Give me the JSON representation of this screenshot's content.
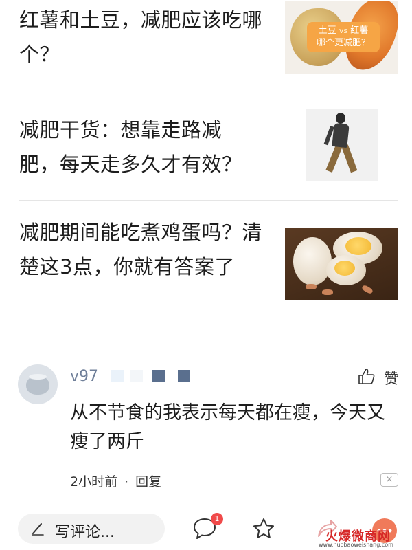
{
  "articles": [
    {
      "title": "红薯和土豆，减肥应该吃哪个？",
      "thumb_label_a": "土豆",
      "thumb_label_vs": "vs",
      "thumb_label_b": "红薯",
      "thumb_label_sub": "哪个更减肥？"
    },
    {
      "title": "减肥干货：想靠走路减肥，每天走多久才有效？"
    },
    {
      "title": "减肥期间能吃煮鸡蛋吗？清楚这3点，你就有答案了"
    }
  ],
  "comment": {
    "username": "v97",
    "like_label": "赞",
    "text": "从不节食的我表示每天都在瘦，今天又瘦了两斤",
    "time": "2小时前",
    "reply_label": "回复",
    "separator": "·",
    "close_symbol": "×"
  },
  "bottom_bar": {
    "write_comment_label": "写评论...",
    "comment_badge": "1"
  },
  "icons": {
    "like": "thumbs-up-icon",
    "pen": "pen-icon",
    "comments": "comment-bubble-icon",
    "favorite": "star-icon",
    "share": "share-icon",
    "more": "more-icon"
  },
  "colors": {
    "username": "#6f7f99",
    "badge": "#f04a4a",
    "thumb_label": "#f6a545",
    "divider": "#e5e5e5"
  }
}
